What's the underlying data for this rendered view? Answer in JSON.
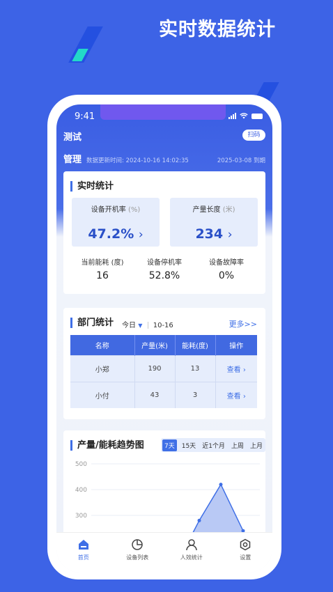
{
  "promo": {
    "headline": "实时数据统计"
  },
  "status": {
    "time": "9:41"
  },
  "header": {
    "app_name": "测试",
    "scan_label": "扫码",
    "org": "管理",
    "update_text": "数据更新时间: 2024-10-16 14:02:35",
    "expire_text": "2025-03-08 到期"
  },
  "realtime": {
    "title": "实时统计",
    "uptime": {
      "label": "设备开机率",
      "unit": "(%)",
      "value": "47.2%"
    },
    "length": {
      "label": "产量长度",
      "unit": "(米)",
      "value": "234"
    },
    "energy": {
      "label": "当前能耗 (度)",
      "value": "16"
    },
    "downtime": {
      "label": "设备停机率",
      "value": "52.8%"
    },
    "fault": {
      "label": "设备故障率",
      "value": "0%"
    }
  },
  "dept": {
    "title": "部门统计",
    "period": "今日",
    "date": "10-16",
    "more": "更多>>",
    "columns": [
      "名称",
      "产量(米)",
      "能耗(度)",
      "操作"
    ],
    "rows": [
      {
        "name": "小郑",
        "output": "190",
        "energy": "13",
        "action": "查看"
      },
      {
        "name": "小付",
        "output": "43",
        "energy": "3",
        "action": "查看"
      }
    ]
  },
  "trend": {
    "title": "产量/能耗趋势图",
    "ranges": [
      "7天",
      "15天",
      "近1个月",
      "上周",
      "上月"
    ],
    "active_range": "7天"
  },
  "chart_data": {
    "type": "area",
    "y_ticks": [
      300,
      400,
      500
    ],
    "ylim": [
      300,
      500
    ],
    "series": [
      {
        "values": [
          280,
          420,
          240
        ]
      }
    ]
  },
  "tabbar": {
    "items": [
      {
        "label": "首页",
        "icon": "home-icon"
      },
      {
        "label": "设备列表",
        "icon": "pie-chart-icon"
      },
      {
        "label": "人效统计",
        "icon": "person-icon"
      },
      {
        "label": "设置",
        "icon": "settings-icon"
      }
    ]
  },
  "colors": {
    "primary": "#3f6fe6",
    "background": "#3d63e6",
    "card_tint": "#e6edfc"
  }
}
